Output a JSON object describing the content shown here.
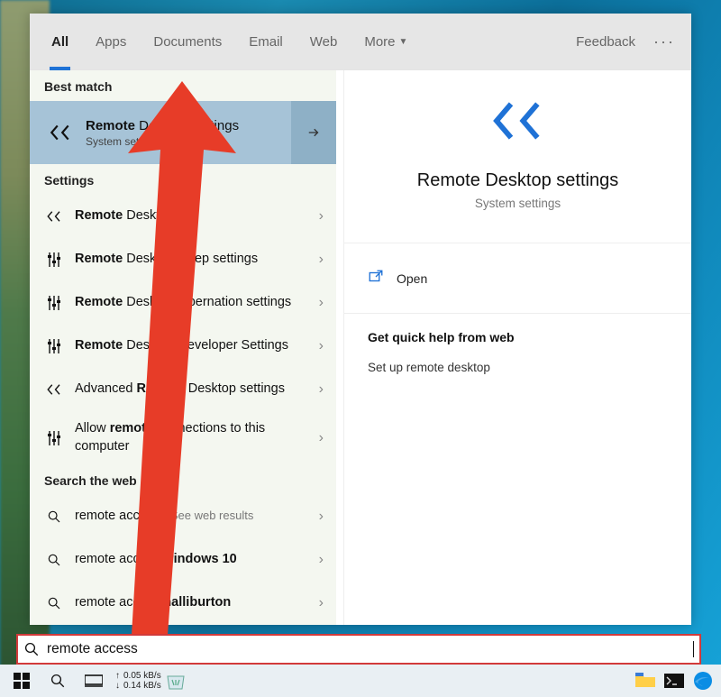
{
  "tabs": {
    "all": "All",
    "apps": "Apps",
    "documents": "Documents",
    "email": "Email",
    "web": "Web",
    "more": "More"
  },
  "header": {
    "feedback": "Feedback"
  },
  "sections": {
    "best_match": "Best match",
    "settings": "Settings",
    "search_web": "Search the web"
  },
  "best_match": {
    "title_pre": "Remote",
    "title_rest": " Desktop settings",
    "sub": "System settings"
  },
  "settings_list": [
    {
      "pre": "Remote",
      "rest": " Desktop",
      "icon": "rd"
    },
    {
      "pre": "Remote",
      "rest": " Desktop sleep settings",
      "icon": "sliders"
    },
    {
      "pre": "Remote",
      "rest": " Desktop hibernation settings",
      "icon": "sliders"
    },
    {
      "pre": "Remote",
      "rest": " Desktop Developer Settings",
      "icon": "sliders"
    },
    {
      "pre2": "Advanced ",
      "mid": "Remote",
      "rest": " Desktop settings",
      "icon": "rd"
    },
    {
      "pre2": "Allow ",
      "mid": "remote",
      "rest": " connections to this computer",
      "icon": "sliders"
    }
  ],
  "web_list": [
    {
      "q": "remote access",
      "hint": " - See web results"
    },
    {
      "q_pre": "remote access ",
      "q_bold": "windows 10"
    },
    {
      "q_pre": "remote access ",
      "q_bold": "halliburton"
    }
  ],
  "detail": {
    "title": "Remote Desktop settings",
    "sub": "System settings",
    "open": "Open",
    "quick_head": "Get quick help from web",
    "quick_link": "Set up remote desktop"
  },
  "search": {
    "value": "remote access"
  },
  "taskbar": {
    "net_up": "0.05 kB/s",
    "net_down": "0.14 kB/s"
  }
}
